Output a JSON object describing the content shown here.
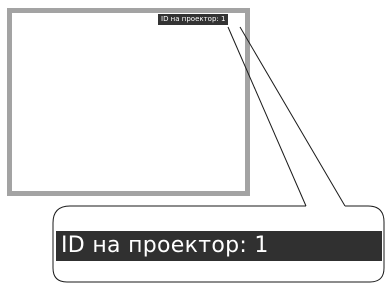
{
  "projector_id": {
    "label": "ID на проектор:",
    "value": "1",
    "text": "ID на проектор:  1"
  },
  "colors": {
    "screen_border": "#a3a3a3",
    "label_background": "#333333",
    "label_text": "#ffffff",
    "callout_stroke": "#1a1a1a"
  }
}
